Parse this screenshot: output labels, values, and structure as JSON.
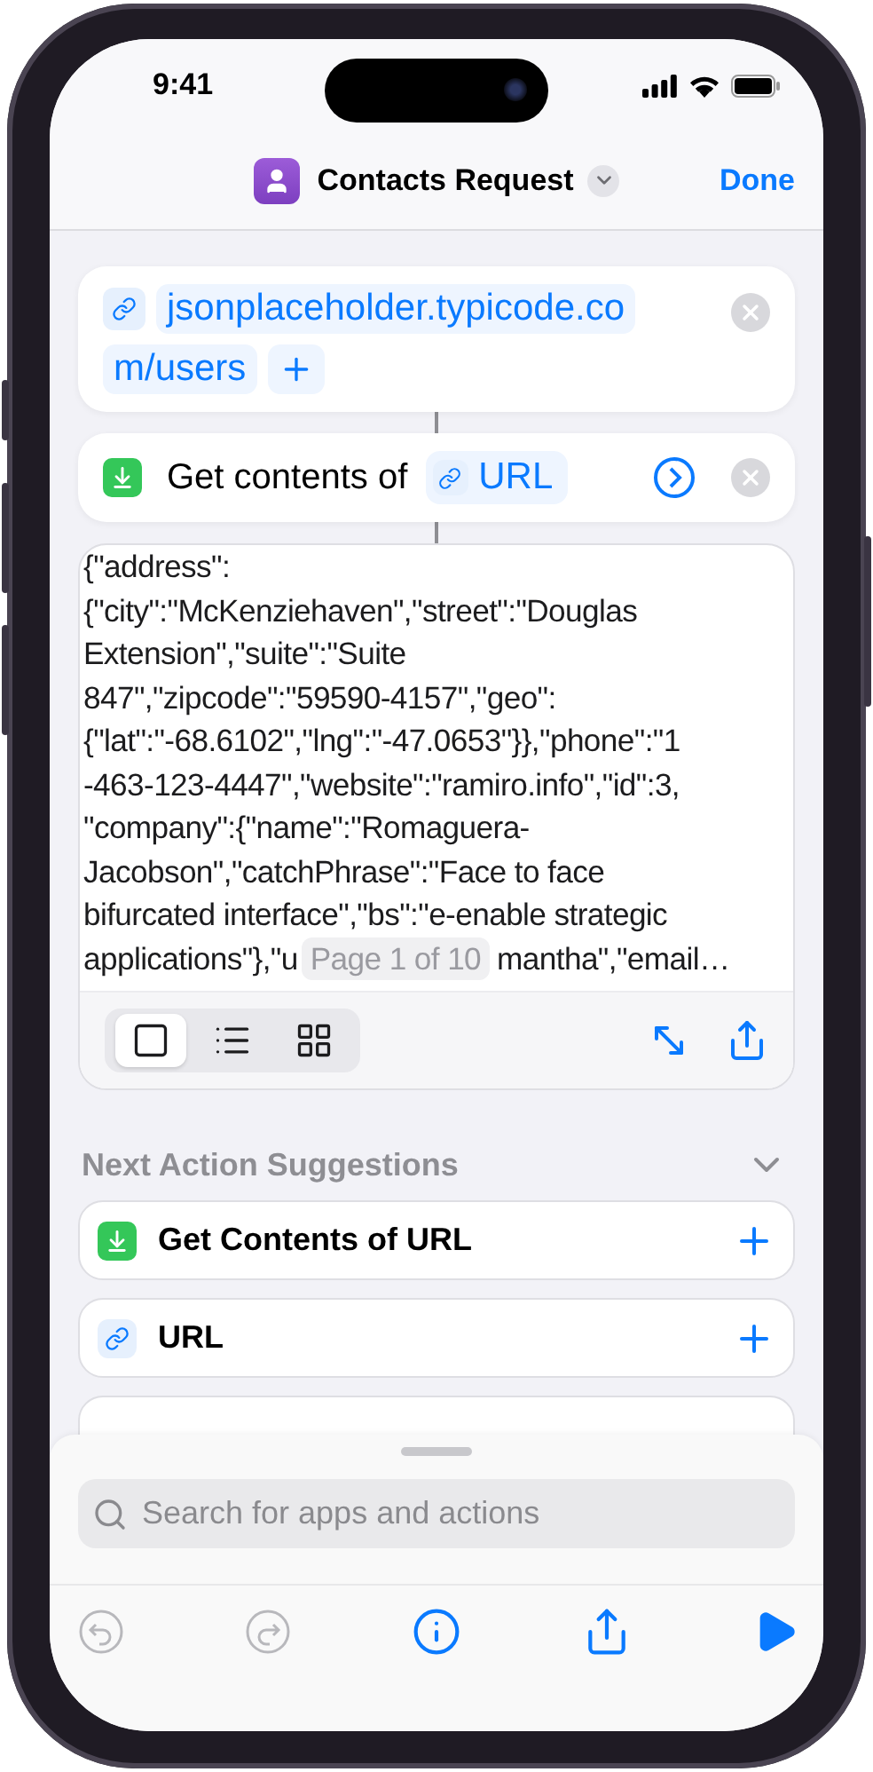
{
  "status_bar": {
    "time": "9:41"
  },
  "nav": {
    "title": "Contacts Request",
    "done": "Done"
  },
  "actions": [
    {
      "kind": "url",
      "url_parts": [
        "jsonplaceholder.typicode.co",
        "m/users"
      ]
    },
    {
      "kind": "get_contents",
      "label": "Get contents of",
      "token": "URL"
    }
  ],
  "result": {
    "lines": [
      "{\"address\":",
      "{\"city\":\"McKenziehaven\",\"street\":\"Douglas",
      "Extension\",\"suite\":\"Suite",
      "847\",\"zipcode\":\"59590-4157\",\"geo\":",
      "{\"lat\":\"-68.6102\",\"lng\":\"-47.0653\"}},\"phone\":\"1",
      "-463-123-4447\",\"website\":\"ramiro.info\",\"id\":3,",
      "\"company\":{\"name\":\"Romaguera-",
      "Jacobson\",\"catchPhrase\":\"Face to face",
      "bifurcated interface\",\"bs\":\"e-enable strategic"
    ],
    "last_line_start": "applications\"},\"u",
    "page_indicator": "Page 1 of 10",
    "last_line_end": "mantha\",\"email…",
    "views": [
      {
        "kind": "single",
        "selected": true
      },
      {
        "kind": "list",
        "selected": false
      },
      {
        "kind": "grid",
        "selected": false
      }
    ]
  },
  "suggestions": {
    "title": "Next Action Suggestions",
    "items": [
      {
        "kind": "get_contents",
        "label": "Get Contents of URL"
      },
      {
        "kind": "url",
        "label": "URL"
      }
    ]
  },
  "search": {
    "placeholder": "Search for apps and actions"
  },
  "toolbar": [
    {
      "kind": "undo",
      "disabled": true
    },
    {
      "kind": "redo",
      "disabled": true
    },
    {
      "kind": "info",
      "disabled": false
    },
    {
      "kind": "share",
      "disabled": false
    },
    {
      "kind": "run",
      "disabled": false
    }
  ]
}
